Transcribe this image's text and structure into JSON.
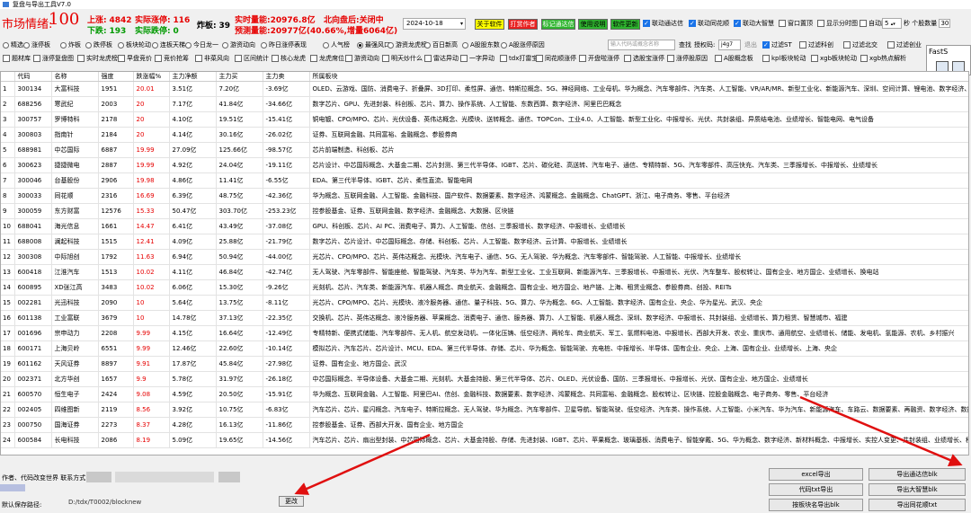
{
  "window": {
    "title": "复盘与导出工具V7.0"
  },
  "info": {
    "market_label": "市场情绪:",
    "market_value": "100",
    "up_label": "上涨:",
    "up_value": "4842",
    "real_zt_label": "实际涨停:",
    "real_zt_value": "116",
    "zhaban_label": "炸板:",
    "zhaban_value": "39",
    "down_label": "下跌:",
    "down_value": "193",
    "real_dt_label": "实际跌停:",
    "real_dt_value": "0",
    "vol_label": "实时量能:",
    "vol_value": "20976.8亿",
    "north_label": "北向盘后:",
    "north_value": "关闭中",
    "pred_label": "预测量能:",
    "pred_value": "20977亿(40.66%,增量6064亿)",
    "date": "2024-10-18"
  },
  "toolbar": {
    "buttons": [
      {
        "label": "关于软件",
        "bg": "#ffff00"
      },
      {
        "label": "打赏作者",
        "bg": "#e82020"
      },
      {
        "label": "标记通达信",
        "bg": "#2fb52f"
      },
      {
        "label": "使用说明",
        "bg": "#2fb52f"
      },
      {
        "label": "软件更新",
        "bg": "#2fb52f"
      }
    ],
    "checks_row1": [
      {
        "label": "联动通达信",
        "checked": true
      },
      {
        "label": "联动同花顺",
        "checked": true
      },
      {
        "label": "联动大智慧",
        "checked": true
      },
      {
        "label": "窗口置顶",
        "checked": false
      },
      {
        "label": "显示分时图",
        "checked": false
      },
      {
        "label": "自动刷新",
        "checked": false
      }
    ],
    "refresh_value": "5",
    "refresh_unit": "秒",
    "stock_count_label": "个股数量",
    "stock_count_value": "30"
  },
  "filters": {
    "row1": [
      {
        "label": "精选",
        "type": "radio",
        "on": false
      },
      {
        "label": "涨停板",
        "type": "radio",
        "on": false
      },
      {
        "label": "炸板",
        "type": "radio",
        "on": false
      },
      {
        "label": "跌停板",
        "type": "radio",
        "on": false
      },
      {
        "label": "板块轮动",
        "type": "radio",
        "on": false
      },
      {
        "label": "连板天梯",
        "type": "radio",
        "on": false
      },
      {
        "label": "今日龙一",
        "type": "radio",
        "on": false
      },
      {
        "label": "游资动向",
        "type": "radio",
        "on": false
      },
      {
        "label": "昨日涨停表现",
        "type": "radio",
        "on": false
      },
      {
        "label": "人气榜",
        "type": "radio",
        "on": false
      },
      {
        "label": "最强风口",
        "type": "radio",
        "on": true
      },
      {
        "label": "游资龙虎榜",
        "type": "radio",
        "on": false
      },
      {
        "label": "百日新高",
        "type": "radio",
        "on": false
      },
      {
        "label": "A股股东数",
        "type": "radio",
        "on": false
      },
      {
        "label": "A股涨停原因",
        "type": "radio",
        "on": false
      }
    ],
    "search_placeholder": "输入代码或概念名称",
    "search_label": "查找",
    "auth_label": "授权码:",
    "auth_value": "j4g7",
    "auth_extra": "退出",
    "row1_checks": [
      {
        "label": "过滤ST",
        "checked": true
      },
      {
        "label": "过滤科创",
        "checked": false
      },
      {
        "label": "过滤北交",
        "checked": false
      },
      {
        "label": "过滤创业",
        "checked": false
      }
    ],
    "row2": [
      "题材库",
      "涨停复盘图",
      "实时龙虎榜",
      "早盘竞价",
      "竞价抢筹",
      "非菜风向",
      "区间统计",
      "核心龙虎",
      "龙虎席位",
      "游资动向",
      "明天炒什么",
      "雷达异动",
      "一字异动",
      "tdx打雷宝",
      "同花顺涨停",
      "开盘啦涨停",
      "选股宝涨停",
      "涨停股原因",
      "A股概念板",
      "kpl板块轮动",
      "xgb板块轮动",
      "xgb热点解析"
    ]
  },
  "float_panel": {
    "title": "FastS"
  },
  "table": {
    "headers": [
      "",
      "代码",
      "名称",
      "强度",
      "跌涨幅%",
      "主力净额",
      "主力买",
      "主力卖",
      "所属板块"
    ],
    "rows": [
      [
        "1",
        "300134",
        "大富科技",
        "1951",
        "20.01",
        "3.51亿",
        "7.20亿",
        "-3.69亿",
        "OLED、云游戏、国防、消费电子、折叠屏、3D打印、柔性屏、通信、特斯拉概念、5G、神经网络、工业母机、华为概念、汽车零部件、汽车类、人工智能、VR/AR/MR、新型工业化、新能源汽车、深圳、空间计算、锂电池、数字经济、央"
      ],
      [
        "2",
        "688256",
        "寒武纪",
        "2003",
        "20",
        "7.17亿",
        "41.84亿",
        "-34.66亿",
        "数字芯片、GPU、先进封装、科创板、芯片、算力、操作系统、人工智能、东数西算、数字经济、阿里巴巴概念"
      ],
      [
        "3",
        "300757",
        "罗博特科",
        "2178",
        "20",
        "4.10亿",
        "19.51亿",
        "-15.41亿",
        "铜电镀、CPO/MPO、芯片、光伏设备、英伟达概念、光模块、送转概念、通信、TOPCon、工业4.0、人工智能、新型工业化、中报增长、光伏、共封装组、异质结电池、业绩增长、智能电网、电气设备"
      ],
      [
        "4",
        "300803",
        "指南针",
        "2184",
        "20",
        "4.14亿",
        "30.16亿",
        "-26.02亿",
        "证券、互联网金融、共同富裕、金融概念、参股券商"
      ],
      [
        "5",
        "688981",
        "中芯国际",
        "6887",
        "19.99",
        "27.09亿",
        "125.66亿",
        "-98.57亿",
        "芯片前端制造、科创板、芯片"
      ],
      [
        "6",
        "300623",
        "捷捷微电",
        "2887",
        "19.99",
        "4.92亿",
        "24.04亿",
        "-19.11亿",
        "芯片设计、中芯国际概念、大基金二期、芯片封测、第三代半导体、IGBT、芯片、碳化硅、高送转、汽车电子、通信、专精特新、5G、汽车零部件、高压快充、汽车类、三季报增长、中报增长、业绩增长"
      ],
      [
        "7",
        "300046",
        "台基股份",
        "2906",
        "19.98",
        "4.86亿",
        "11.41亿",
        "-6.55亿",
        "EDA、第三代半导体、IGBT、芯片、柔性直流、智能电网"
      ],
      [
        "8",
        "300033",
        "同花顺",
        "2316",
        "16.69",
        "6.39亿",
        "48.75亿",
        "-42.36亿",
        "华为概念、互联网金融、人工智能、金融科技、国产软件、数据要素、数字经济、鸿蒙概念、金融概念、ChatGPT、浙江、电子商务、零售、平台经济"
      ],
      [
        "9",
        "300059",
        "东方财富",
        "12576",
        "15.33",
        "50.47亿",
        "303.70亿",
        "-253.23亿",
        "控参股基金、证券、互联网金融、数字经济、金融概念、大数据、区块链"
      ],
      [
        "10",
        "688041",
        "海光信息",
        "1661",
        "14.47",
        "6.41亿",
        "43.49亿",
        "-37.08亿",
        "GPU、科创板、芯片、AI PC、消费电子、算力、人工智能、信创、三季报增长、数字经济、中报增长、业绩增长"
      ],
      [
        "11",
        "688008",
        "澜起科技",
        "1515",
        "12.41",
        "4.09亿",
        "25.88亿",
        "-21.79亿",
        "数字芯片、芯片设计、中芯国际概念、存储、科创板、芯片、人工智能、数字经济、云计算、中报增长、业绩增长"
      ],
      [
        "12",
        "300308",
        "中际旭创",
        "1792",
        "11.63",
        "6.94亿",
        "50.94亿",
        "-44.00亿",
        "光芯片、CPO/MPO、芯片、英伟达概念、光模块、汽车电子、通信、5G、无人驾驶、华为概念、汽车零部件、智能驾驶、人工智能、中报增长、业绩增长"
      ],
      [
        "13",
        "600418",
        "江淮汽车",
        "1513",
        "10.02",
        "4.11亿",
        "46.84亿",
        "-42.74亿",
        "无人驾驶、汽车零部件、智能座舱、智能驾驶、汽车类、华为汽车、新型工业化、工业互联网、新能源汽车、三季报增长、中报增长、光伏、汽车整车、股权转让、国有企业、地方国企、业绩增长、换电站"
      ],
      [
        "14",
        "600895",
        "XD张江高",
        "3483",
        "10.02",
        "6.06亿",
        "15.30亿",
        "-9.26亿",
        "光刻机、芯片、汽车类、新能源汽车、机器人概念、商业航天、金融概念、国有企业、地方国企、地产链、上海、租赁业概念、参股券商、创投、REITs"
      ],
      [
        "15",
        "002281",
        "光迅科技",
        "2090",
        "10",
        "5.64亿",
        "13.75亿",
        "-8.11亿",
        "光芯片、CPO/MPO、芯片、光模块、液冷服务器、通信、量子科技、5G、算力、华为概念、6G、人工智能、数字经济、国有企业、央企、华为星光、武汉、央企"
      ],
      [
        "16",
        "601138",
        "工业富联",
        "3679",
        "10",
        "14.78亿",
        "37.13亿",
        "-22.35亿",
        "交换机、芯片、英伟达概念、液冷服务器、苹果概念、消费电子、通信、服务器、算力、人工智能、机器人概念、深圳、数字经济、中报增长、共封装组、业绩增长、算力租赁、智慧城市、福建"
      ],
      [
        "17",
        "001696",
        "宗申动力",
        "2208",
        "9.99",
        "4.15亿",
        "16.64亿",
        "-12.49亿",
        "专精特新、便携式储能、汽车零部件、无人机、航空发动机、一体化压铸、低空经济、两轮车、商业航天、军工、氢燃料电池、中报增长、西部大开发、农业、重庆市、通用航空、业绩增长、储能、发电机、氢能源、农机、乡村振兴"
      ],
      [
        "18",
        "600171",
        "上海贝岭",
        "6551",
        "9.99",
        "12.46亿",
        "22.60亿",
        "-10.14亿",
        "模拟芯片、汽车芯片、芯片设计、MCU、EDA、第三代半导体、存储、芯片、华为概念、智能驾驶、充电桩、中报增长、半导体、国有企业、央企、上海、国有企业、业绩增长、上海、央企"
      ],
      [
        "19",
        "601162",
        "天风证券",
        "8897",
        "9.91",
        "17.87亿",
        "45.84亿",
        "-27.98亿",
        "证券、国有企业、地方国企、武汉"
      ],
      [
        "20",
        "002371",
        "北方华创",
        "1657",
        "9.9",
        "5.78亿",
        "31.97亿",
        "-26.18亿",
        "中芯国际概念、半导体设备、大基金二期、光刻机、大基金持股、第三代半导体、芯片、OLED、光伏设备、国防、三季报增长、中报增长、光伏、国有企业、地方国企、业绩增长"
      ],
      [
        "21",
        "600570",
        "恒生电子",
        "2424",
        "9.08",
        "4.59亿",
        "20.50亿",
        "-15.91亿",
        "华为概念、互联网金融、人工智能、阿里巴AI、信创、金融科技、数据要素、数字经济、鸿蒙概念、共同富裕、金融概念、股权转让、区块链、控股金融概念、电子商务、零售、平台经济"
      ],
      [
        "22",
        "002405",
        "四维图新",
        "2119",
        "8.56",
        "3.92亿",
        "10.75亿",
        "-6.83亿",
        "汽车芯片、芯片、星闪概念、汽车电子、特斯拉概念、无人驾驶、华为概念、汽车零部件、卫星导航、智能驾驶、低空经济、汽车类、操作系统、人工智能、小米汽车、华为汽车、新能源汽车、车路云、数据要素、再融资、数字经济、数据要"
      ],
      [
        "23",
        "000750",
        "国海证券",
        "2273",
        "8.37",
        "4.28亿",
        "16.13亿",
        "-11.86亿",
        "控参股基金、证券、西部大开发、国有企业、地方国企"
      ],
      [
        "24",
        "600584",
        "长电科技",
        "2086",
        "8.19",
        "5.09亿",
        "19.65亿",
        "-14.56亿",
        "汽车芯片、芯片、扇出型封装、中芯国际概念、芯片、大基金持股、存储、先进封装、IGBT、芯片、苹果概念、玻璃基板、消费电子、智能穿戴、5G、华为概念、数字经济、新材料概念、中报增长、实控人变更、共封装组、业绩增长、移动支付"
      ]
    ]
  },
  "bottom": {
    "left_label": "作者、代码改变世界 联系方式",
    "path_label": "默认保存路径:",
    "path_value": "D:/tdx/T0002/blocknew",
    "change_btn": "更改",
    "export_buttons": [
      "excel导出",
      "导出通达信blk",
      "代码txt导出",
      "导出大智慧blk",
      "按板块名导出blk",
      "导出同花顺txt"
    ]
  }
}
